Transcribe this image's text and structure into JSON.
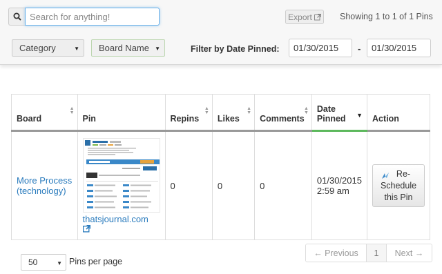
{
  "search": {
    "placeholder": "Search for anything!"
  },
  "toolbar": {
    "export_label": "Export",
    "showing_text": "Showing 1 to 1 of 1 Pins",
    "category_select": "Category",
    "board_select": "Board Name",
    "filter_label": "Filter by Date Pinned:",
    "date_from": "01/30/2015",
    "date_separator": "-",
    "date_to": "01/30/2015"
  },
  "table": {
    "headers": {
      "board": "Board",
      "pin": "Pin",
      "repins": "Repins",
      "likes": "Likes",
      "comments": "Comments",
      "date_pinned_line1": "Date",
      "date_pinned_line2": "Pinned",
      "action": "Action"
    },
    "rows": [
      {
        "board_line1": "More Process",
        "board_line2": "(technology)",
        "pin_source": "thatsjournal.com",
        "repins": "0",
        "likes": "0",
        "comments": "0",
        "date_line1": "01/30/2015",
        "date_line2": "2:59 am",
        "action_line1": "Re-",
        "action_line2": "Schedule",
        "action_line3": "this Pin"
      }
    ]
  },
  "footer": {
    "per_page_value": "50",
    "per_page_label": "Pins per page",
    "prev_label": "← Previous",
    "page_number": "1",
    "next_label": "Next →"
  },
  "colors": {
    "accent_link": "#2a7bbd",
    "active_sort_underline": "#5cb85c",
    "focus_border": "#66afe9"
  }
}
